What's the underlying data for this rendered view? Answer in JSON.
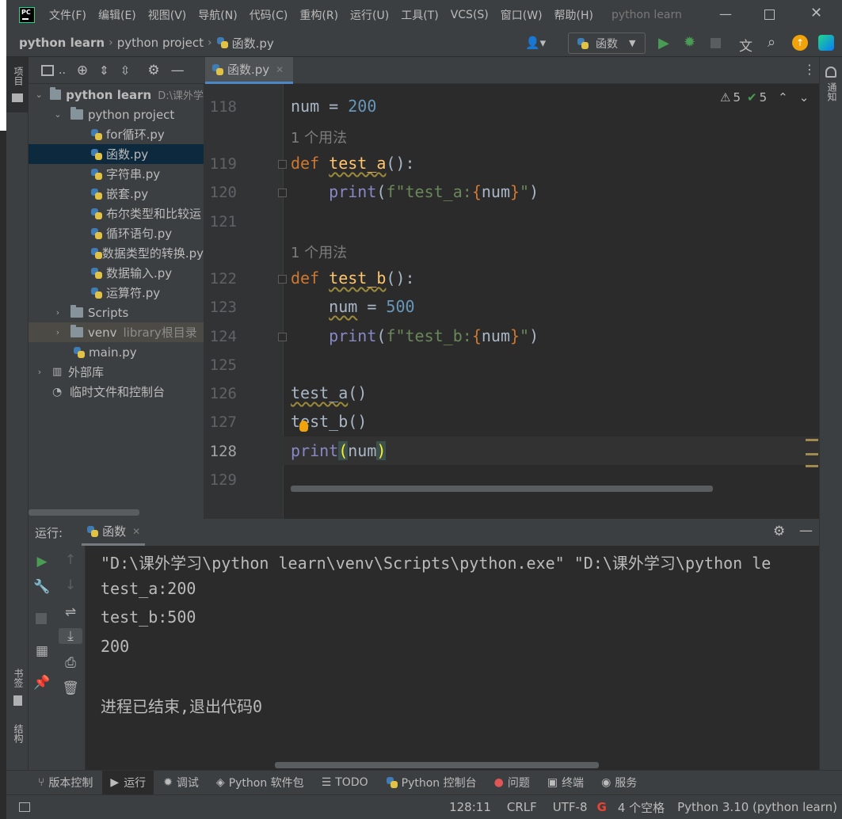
{
  "menubar": {
    "items": [
      "文件(F)",
      "编辑(E)",
      "视图(V)",
      "导航(N)",
      "代码(C)",
      "重构(R)",
      "运行(U)",
      "工具(T)",
      "VCS(S)",
      "窗口(W)",
      "帮助(H)"
    ],
    "window_title": "python learn"
  },
  "navbar": {
    "crumbs": [
      "python learn",
      "python project",
      "函数.py"
    ],
    "run_config": "函数"
  },
  "left_strip": {
    "project_tab": "项目",
    "bookmarks_tab": "书签",
    "structure_tab": "结构"
  },
  "right_strip": {
    "notifications_tab": "通知"
  },
  "project": {
    "head_label": "..",
    "tree": [
      {
        "label": "python learn",
        "suffix": "D:\\课外学",
        "type": "folder",
        "expanded": true
      },
      {
        "label": "python project",
        "type": "folder",
        "expanded": true
      },
      {
        "label": "for循环.py",
        "type": "py"
      },
      {
        "label": "函数.py",
        "type": "py",
        "selected": true
      },
      {
        "label": "字符串.py",
        "type": "py"
      },
      {
        "label": "嵌套.py",
        "type": "py"
      },
      {
        "label": "布尔类型和比较运",
        "type": "py"
      },
      {
        "label": "循环语句.py",
        "type": "py"
      },
      {
        "label": "数据类型的转换.py",
        "type": "py"
      },
      {
        "label": "数据输入.py",
        "type": "py"
      },
      {
        "label": "运算符.py",
        "type": "py"
      },
      {
        "label": "Scripts",
        "type": "folder"
      },
      {
        "label": "venv",
        "suffix": "library根目录",
        "type": "folder"
      },
      {
        "label": "main.py",
        "type": "py"
      },
      {
        "label": "外部库",
        "type": "lib"
      },
      {
        "label": "临时文件和控制台",
        "type": "scratch"
      }
    ]
  },
  "editor": {
    "tab_label": "函数.py",
    "inspections": {
      "warnings": "5",
      "weak_warnings": "5"
    },
    "line_numbers": [
      "118",
      "119",
      "120",
      "121",
      "122",
      "123",
      "124",
      "125",
      "126",
      "127",
      "128",
      "129"
    ],
    "usage_hint": "1 个用法",
    "current_line": "128"
  },
  "run": {
    "label": "运行:",
    "tab_label": "函数",
    "output": [
      "\"D:\\课外学习\\python learn\\venv\\Scripts\\python.exe\" \"D:\\课外学习\\python le",
      "test_a:200",
      "test_b:500",
      "200",
      "",
      "进程已结束,退出代码0"
    ]
  },
  "bottom_tabs": [
    "版本控制",
    "运行",
    "调试",
    "Python 软件包",
    "TODO",
    "Python 控制台",
    "问题",
    "终端",
    "服务"
  ],
  "status": {
    "position": "128:11",
    "line_sep": "CRLF",
    "encoding": "UTF-8",
    "indent": "4 个空格",
    "interpreter": "Python 3.10 (python learn)"
  }
}
